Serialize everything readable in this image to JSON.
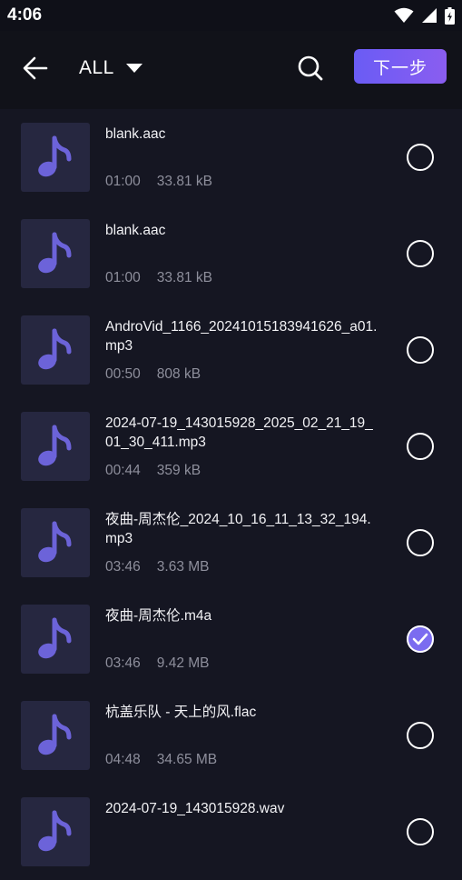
{
  "status": {
    "time": "4:06"
  },
  "toolbar": {
    "filter_label": "ALL",
    "next_label": "下一步"
  },
  "files": [
    {
      "name": "blank.aac",
      "duration": "01:00",
      "size": "33.81 kB",
      "selected": false
    },
    {
      "name": "blank.aac",
      "duration": "01:00",
      "size": "33.81 kB",
      "selected": false
    },
    {
      "name": "AndroVid_1166_20241015183941626_a01.mp3",
      "duration": "00:50",
      "size": "808 kB",
      "selected": false
    },
    {
      "name": "2024-07-19_143015928_2025_02_21_19_01_30_411.mp3",
      "duration": "00:44",
      "size": "359 kB",
      "selected": false
    },
    {
      "name": "夜曲-周杰伦_2024_10_16_11_13_32_194.mp3",
      "duration": "03:46",
      "size": "3.63 MB",
      "selected": false
    },
    {
      "name": "夜曲-周杰伦.m4a",
      "duration": "03:46",
      "size": "9.42 MB",
      "selected": true
    },
    {
      "name": "杭盖乐队 - 天上的风.flac",
      "duration": "04:48",
      "size": "34.65 MB",
      "selected": false
    },
    {
      "name": "2024-07-19_143015928.wav",
      "duration": "",
      "size": "",
      "selected": false
    }
  ],
  "colors": {
    "background": "#151622",
    "accent": "#7b6cf0",
    "thumb_bg": "#262740",
    "note_color": "#6c63d9"
  },
  "icons": {
    "back": "arrow-left-icon",
    "filter": "caret-down-icon",
    "search": "search-icon",
    "note": "music-note-icon",
    "check": "check-icon"
  }
}
